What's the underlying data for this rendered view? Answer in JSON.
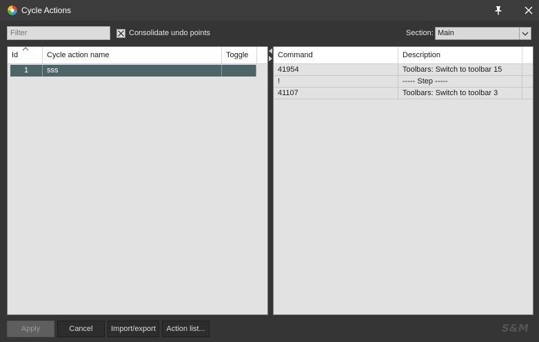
{
  "window": {
    "title": "Cycle Actions"
  },
  "toolbar": {
    "filter_placeholder": "Filter",
    "consolidate_label": "Consolidate undo points",
    "consolidate_checked": true,
    "section_label": "Section:",
    "section_value": "Main"
  },
  "left_table": {
    "columns": [
      "Id",
      "Cycle action name",
      "Toggle"
    ],
    "sort_column": "Id",
    "rows": [
      {
        "id": "1",
        "name": "sss",
        "toggle": ""
      }
    ]
  },
  "right_table": {
    "columns": [
      "Command",
      "Description"
    ],
    "rows": [
      {
        "command": "41954",
        "description": "Toolbars: Switch to toolbar 15"
      },
      {
        "command": "!",
        "description": "----- Step -----"
      },
      {
        "command": "41107",
        "description": "Toolbars: Switch to toolbar 3"
      }
    ]
  },
  "buttons": {
    "apply": "Apply",
    "cancel": "Cancel",
    "import_export": "Import/export",
    "action_list": "Action list..."
  },
  "brand": "S&M",
  "colors": {
    "selected_row": "#4d6468",
    "background": "#353535"
  }
}
